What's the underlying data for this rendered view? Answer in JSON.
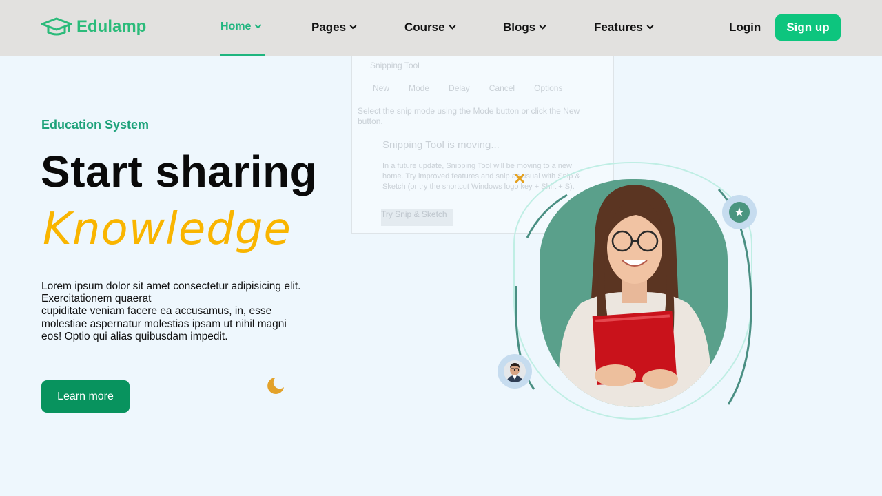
{
  "brand": {
    "name": "Edulamp",
    "color": "#2bbb7a"
  },
  "nav": {
    "items": [
      {
        "label": "Home",
        "active": true
      },
      {
        "label": "Pages",
        "active": false
      },
      {
        "label": "Course",
        "active": false
      },
      {
        "label": "Blogs",
        "active": false
      },
      {
        "label": "Features",
        "active": false
      }
    ],
    "login_label": "Login",
    "signup_label": "Sign up"
  },
  "overlay": {
    "title": "Snipping Tool",
    "tools": [
      "New",
      "Mode",
      "Delay",
      "Cancel",
      "Options"
    ],
    "hint": "Select the snip mode using the Mode button or click the New button.",
    "heading": "Snipping Tool is moving...",
    "body": "In a future update, Snipping Tool will be moving to a new home. Try improved features and snip as usual with Snip & Sketch (or try the shortcut Windows logo key + Shift + S).",
    "button": "Try Snip & Sketch"
  },
  "hero": {
    "eyebrow": "Education System",
    "headline": "Start sharing",
    "highlight": "Knowledge",
    "description_line1": "Lorem ipsum dolor sit amet consectetur adipisicing elit. Exercitationem quaerat",
    "description_line2": "cupiditate veniam facere ea accusamus, in, esse molestiae aspernatur molestias ipsam ut nihil magni eos! Optio qui alias quibusdam impedit.",
    "cta_label": "Learn more"
  },
  "decor": {
    "cross_glyph": "✕",
    "star_glyph": "★"
  },
  "colors": {
    "accent": "#0dc57e",
    "cta": "#08935e",
    "highlight": "#f9b500",
    "eyebrow": "#1da27a",
    "portrait_bg": "#5aa08b"
  }
}
